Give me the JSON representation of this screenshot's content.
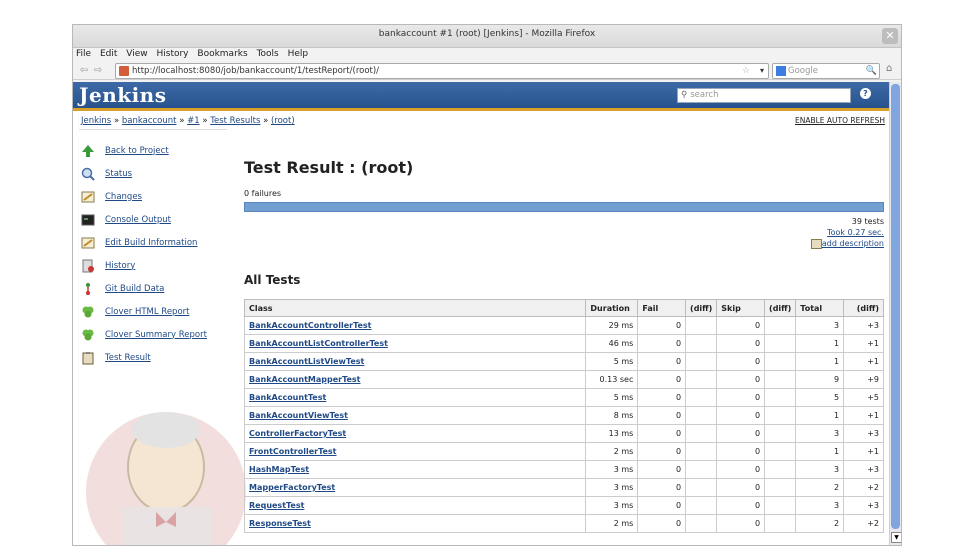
{
  "window": {
    "title": "bankaccount #1 (root) [Jenkins] - Mozilla Firefox"
  },
  "menu": [
    "File",
    "Edit",
    "View",
    "History",
    "Bookmarks",
    "Tools",
    "Help"
  ],
  "url": "http://localhost:8080/job/bankaccount/1/testReport/(root)/",
  "search_engine_placeholder": "Google",
  "jenkins": {
    "logo": "Jenkins",
    "search_placeholder": "search",
    "help": "?"
  },
  "breadcrumb": {
    "items": [
      "Jenkins",
      "bankaccount",
      "#1",
      "Test Results",
      "(root)"
    ],
    "sep": "»"
  },
  "enable_auto_refresh": "ENABLE AUTO REFRESH",
  "sidebar": {
    "items": [
      {
        "label": "Back to Project",
        "icon": "up-arrow-icon"
      },
      {
        "label": "Status",
        "icon": "search-icon"
      },
      {
        "label": "Changes",
        "icon": "notepad-icon"
      },
      {
        "label": "Console Output",
        "icon": "terminal-icon"
      },
      {
        "label": "Edit Build Information",
        "icon": "notepad-pencil-icon"
      },
      {
        "label": "History",
        "icon": "history-icon"
      },
      {
        "label": "Git Build Data",
        "icon": "git-icon"
      },
      {
        "label": "Clover HTML Report",
        "icon": "clover-icon"
      },
      {
        "label": "Clover Summary Report",
        "icon": "clover-icon"
      },
      {
        "label": "Test Result",
        "icon": "clipboard-icon"
      }
    ]
  },
  "main": {
    "title": "Test Result : (root)",
    "failures": "0 failures",
    "tests_count": "39 tests",
    "took": "Took 0.27 sec.",
    "add_description": "add description",
    "section_title": "All Tests"
  },
  "table": {
    "headers": [
      "Class",
      "Duration",
      "Fail",
      "(diff)",
      "Skip",
      "(diff)",
      "Total",
      "(diff)"
    ],
    "rows": [
      [
        "BankAccountControllerTest",
        "29 ms",
        "0",
        "",
        "0",
        "",
        "3",
        "+3"
      ],
      [
        "BankAccountListControllerTest",
        "46 ms",
        "0",
        "",
        "0",
        "",
        "1",
        "+1"
      ],
      [
        "BankAccountListViewTest",
        "5 ms",
        "0",
        "",
        "0",
        "",
        "1",
        "+1"
      ],
      [
        "BankAccountMapperTest",
        "0.13 sec",
        "0",
        "",
        "0",
        "",
        "9",
        "+9"
      ],
      [
        "BankAccountTest",
        "5 ms",
        "0",
        "",
        "0",
        "",
        "5",
        "+5"
      ],
      [
        "BankAccountViewTest",
        "8 ms",
        "0",
        "",
        "0",
        "",
        "1",
        "+1"
      ],
      [
        "ControllerFactoryTest",
        "13 ms",
        "0",
        "",
        "0",
        "",
        "3",
        "+3"
      ],
      [
        "FrontControllerTest",
        "2 ms",
        "0",
        "",
        "0",
        "",
        "1",
        "+1"
      ],
      [
        "HashMapTest",
        "3 ms",
        "0",
        "",
        "0",
        "",
        "3",
        "+3"
      ],
      [
        "MapperFactoryTest",
        "3 ms",
        "0",
        "",
        "0",
        "",
        "2",
        "+2"
      ],
      [
        "RequestTest",
        "3 ms",
        "0",
        "",
        "0",
        "",
        "3",
        "+3"
      ],
      [
        "ResponseTest",
        "2 ms",
        "0",
        "",
        "0",
        "",
        "2",
        "+2"
      ]
    ]
  },
  "colors": {
    "header": "#27528c",
    "bar": "#729fcf",
    "link": "#204a87"
  }
}
